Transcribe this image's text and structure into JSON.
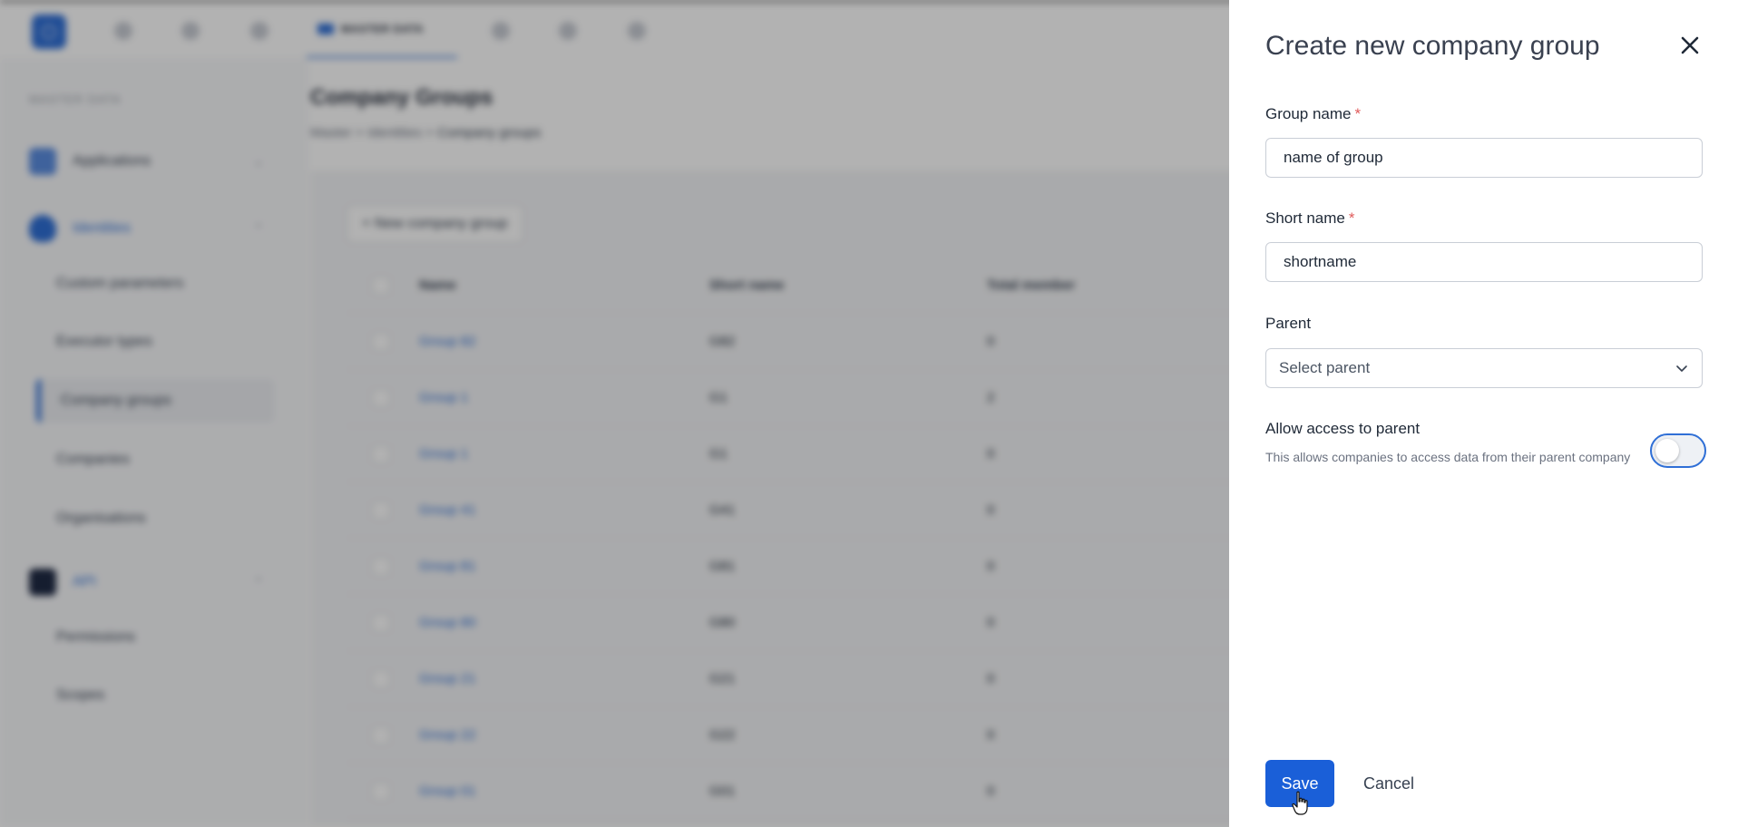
{
  "topbar": {
    "active_tab_label": "MASTER DATA"
  },
  "sidebar": {
    "heading": "MASTER DATA",
    "sections": [
      {
        "label": "Applications"
      },
      {
        "label": "Identities"
      },
      {
        "label": "API"
      }
    ],
    "identities_items": [
      "Custom parameters",
      "Executor types",
      "Company groups",
      "Companies",
      "Organisations"
    ],
    "api_items": [
      "Permissions",
      "Scopes"
    ]
  },
  "main": {
    "title": "Company Groups",
    "breadcrumb": [
      "Master",
      "Identities",
      "Company groups"
    ],
    "new_button_label": "+ New company group",
    "columns": [
      "Name",
      "Short name",
      "Total member"
    ],
    "rows": [
      {
        "name": "Group 82",
        "short": "G82",
        "total": "0"
      },
      {
        "name": "Group 1",
        "short": "G1",
        "total": "2"
      },
      {
        "name": "Group 1",
        "short": "G1",
        "total": "0"
      },
      {
        "name": "Group 41",
        "short": "G41",
        "total": "0"
      },
      {
        "name": "Group 81",
        "short": "G81",
        "total": "0"
      },
      {
        "name": "Group 80",
        "short": "G80",
        "total": "0"
      },
      {
        "name": "Group 21",
        "short": "G21",
        "total": "0"
      },
      {
        "name": "Group 22",
        "short": "G22",
        "total": "0"
      },
      {
        "name": "Group 01",
        "short": "G01",
        "total": "0"
      }
    ]
  },
  "drawer": {
    "title": "Create new company group",
    "group_name": {
      "label": "Group name",
      "required_mark": "*",
      "value": "name of group"
    },
    "short_name": {
      "label": "Short name",
      "required_mark": "*",
      "value": "shortname"
    },
    "parent": {
      "label": "Parent",
      "placeholder": "Select parent"
    },
    "allow_access": {
      "label": "Allow access to parent",
      "description": "This allows companies to access data from their parent company",
      "enabled": false
    },
    "save_label": "Save",
    "cancel_label": "Cancel"
  },
  "colors": {
    "accent": "#1a5fd8",
    "required": "#e05a5a"
  }
}
